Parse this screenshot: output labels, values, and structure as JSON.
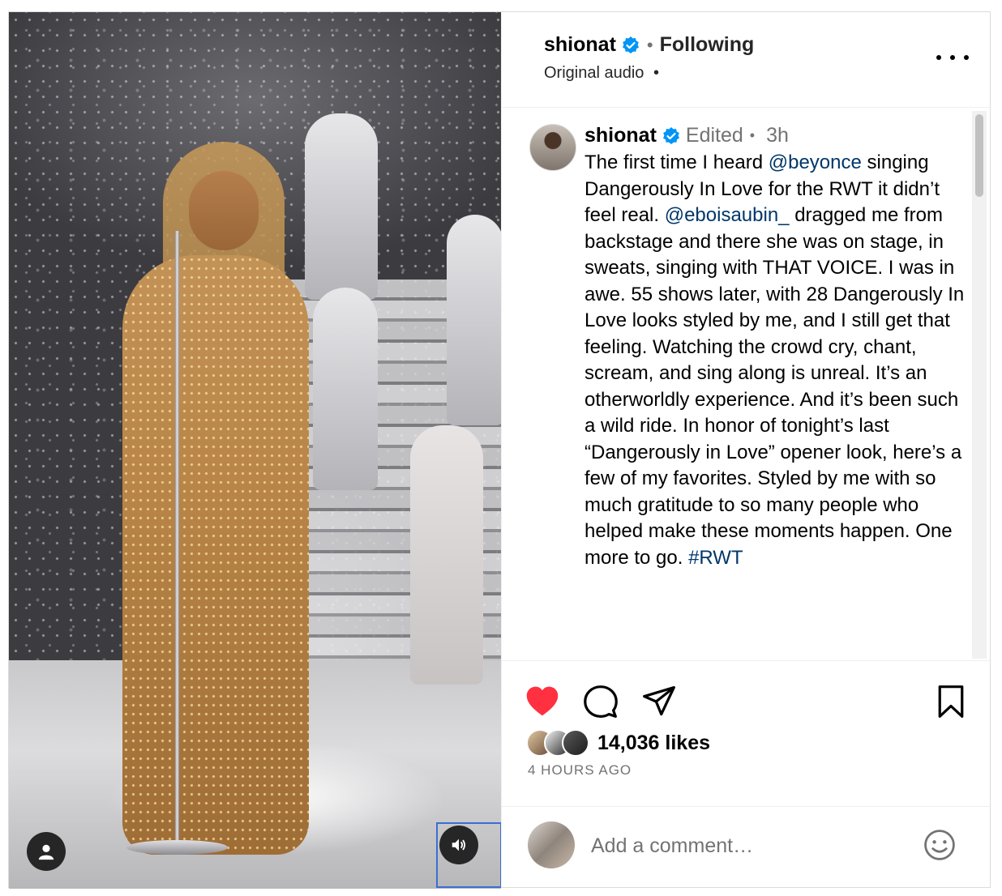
{
  "header": {
    "username": "shionat",
    "following_label": "Following",
    "audio_label": "Original audio",
    "audio_dot": "•"
  },
  "caption": {
    "username": "shionat",
    "edited_label": "Edited",
    "time": "3h",
    "text_before_mention1": "The first time I heard ",
    "mention1": "@beyonce",
    "text_before_mention2": " singing Dangerously In Love for the RWT it didn’t feel real. ",
    "mention2": "@eboisaubin_",
    "text_before_hashtag": " dragged me from backstage and there she was on stage, in sweats, singing with THAT VOICE. I was in awe. 55 shows later, with 28 Dangerously In Love looks styled by me, and I still get that feeling. Watching the crowd cry, chant, scream, and sing along is unreal. It’s an otherworldly experience. And it’s been such a wild ride. In honor of tonight’s last “Dangerously in Love” opener look, here’s a few of my favorites. Styled by me with so much gratitude to so many people who helped make these moments happen. One more to go. ",
    "hashtag": "#RWT"
  },
  "actions": {
    "likes": "14,036 likes",
    "time_ago": "4 HOURS AGO",
    "like_icon": "heart-filled-icon",
    "comment_icon": "comment-icon",
    "share_icon": "share-icon",
    "save_icon": "bookmark-icon"
  },
  "comment": {
    "placeholder": "Add a comment…"
  },
  "colors": {
    "like": "#ff3040",
    "link": "#00376b",
    "verified": "#0095f6",
    "secondary_text": "#737373"
  }
}
